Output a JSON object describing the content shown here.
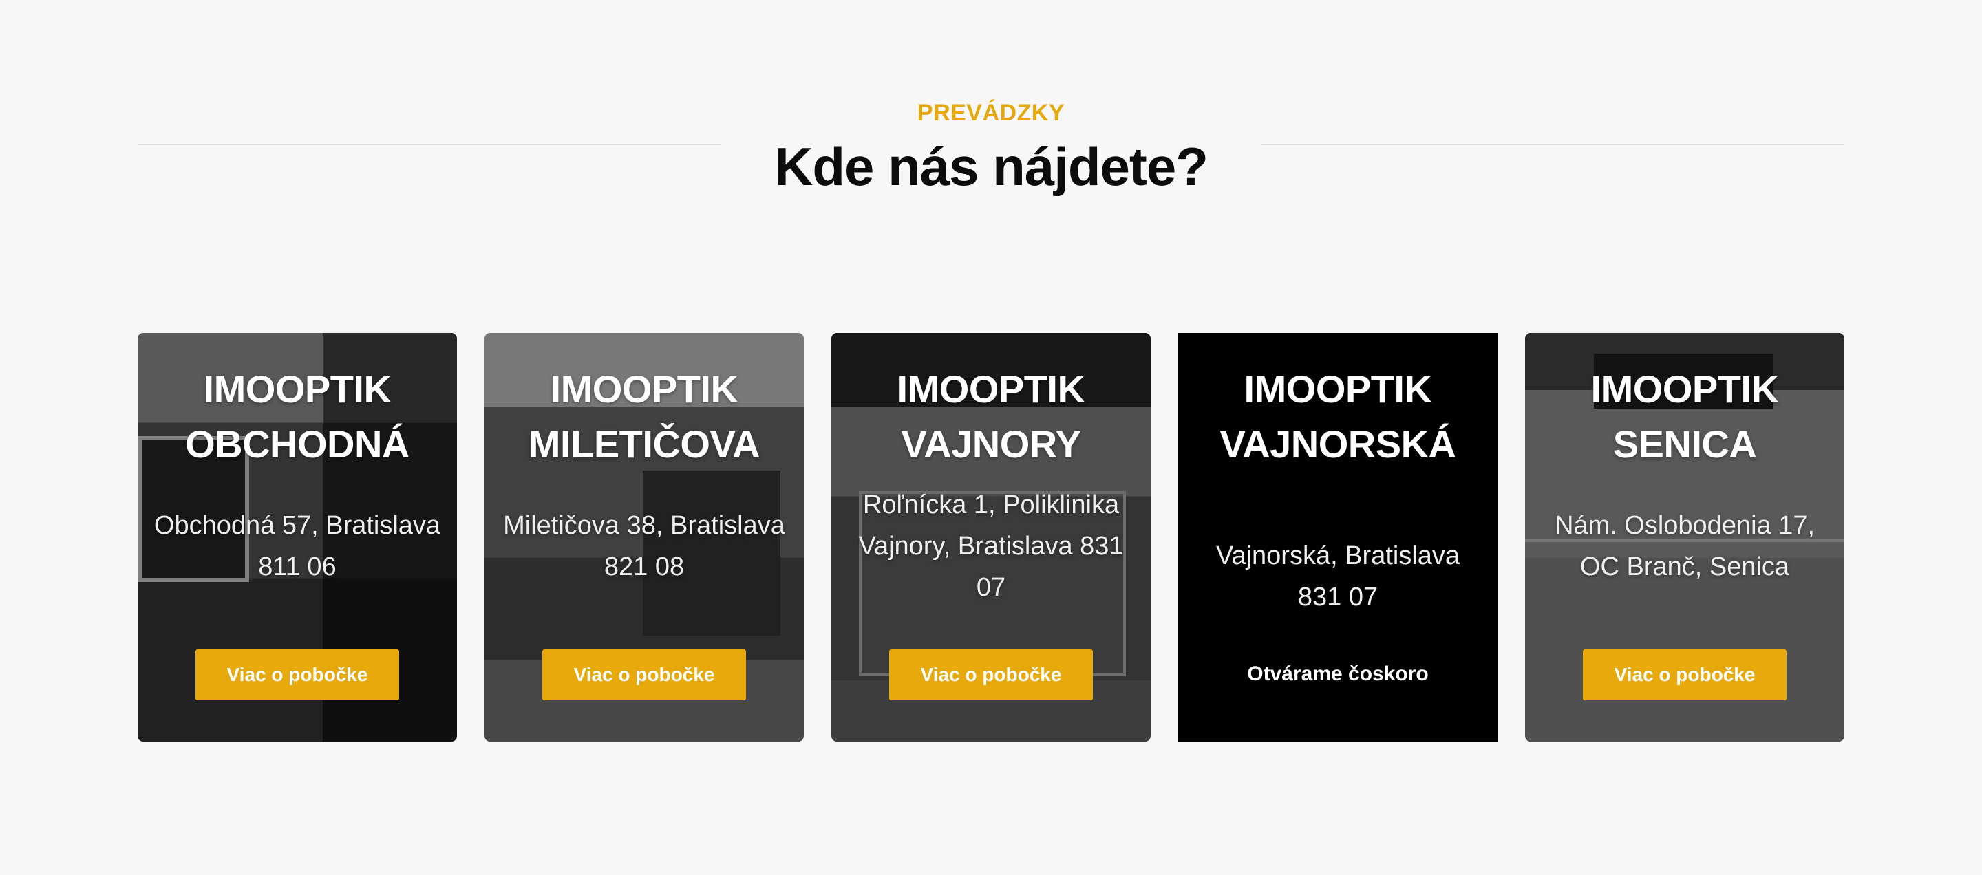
{
  "header": {
    "eyebrow": "PREVÁDZKY",
    "title": "Kde nás nájdete?"
  },
  "branches": [
    {
      "name": "IMOOPTIK OBCHODNÁ",
      "address": "Obchodná 57, Bratislava 811 06",
      "button": "Viac o pobočke"
    },
    {
      "name": "IMOOPTIK MILETIČOVA",
      "address": "Miletičova 38, Bratislava 821 08",
      "button": "Viac o pobočke"
    },
    {
      "name": "IMOOPTIK VAJNORY",
      "address": "Roľnícka 1, Poliklinika Vajnory, Bratislava 831 07",
      "button": "Viac o pobočke"
    },
    {
      "name": "IMOOPTIK VAJNORSKÁ",
      "address": "Vajnorská, Bratislava 831 07",
      "status": "Otvárame čoskoro"
    },
    {
      "name": "IMOOPTIK SENICA",
      "address": "Nám. Oslobodenia 17, OC Branč, Senica",
      "button": "Viac o pobočke"
    }
  ],
  "colors": {
    "accent": "#e8a90c",
    "eyebrow": "#e6a80a",
    "background": "#f7f7f7",
    "title": "#0c0c0c"
  }
}
